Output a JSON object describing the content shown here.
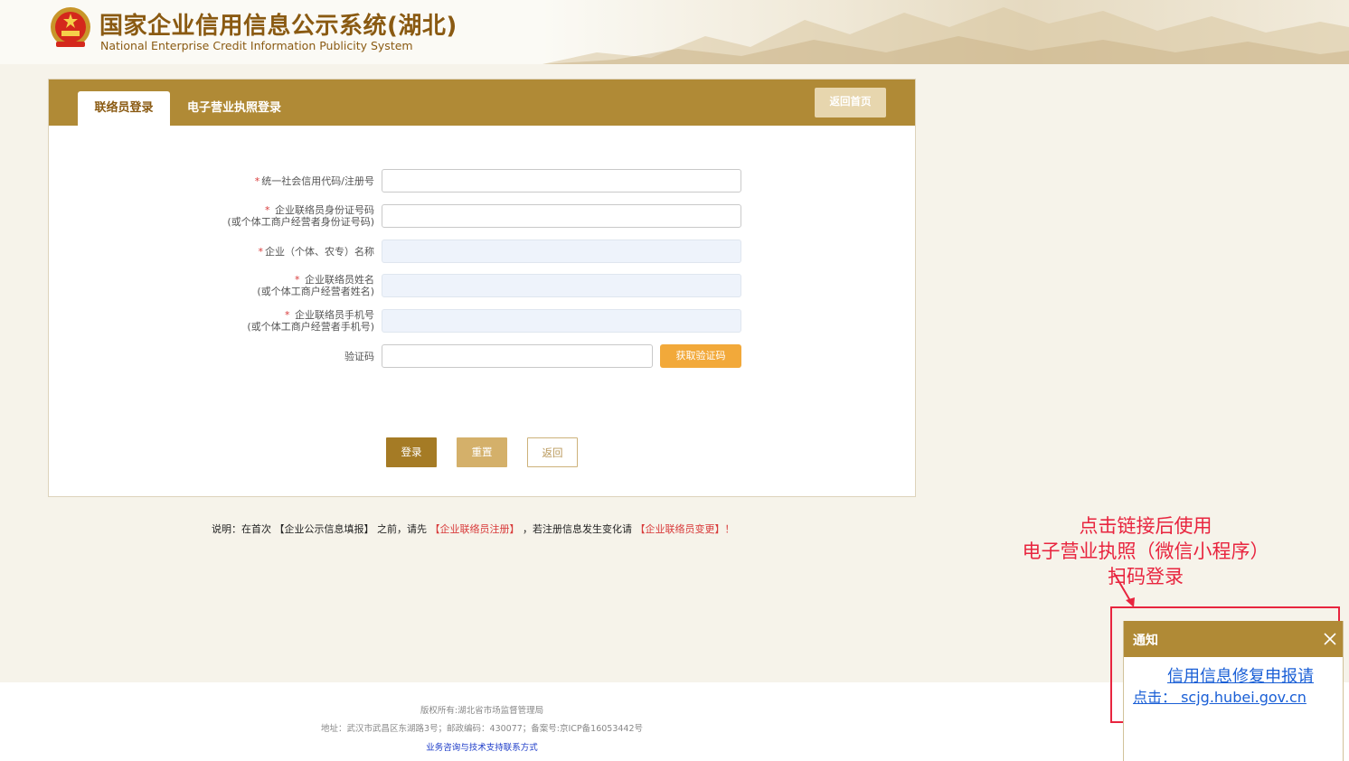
{
  "header": {
    "title": "国家企业信用信息公示系统(湖北)",
    "subtitle": "National Enterprise Credit Information Publicity System"
  },
  "tabs": [
    {
      "label": "联络员登录",
      "active": true
    },
    {
      "label": "电子营业执照登录",
      "active": false
    }
  ],
  "home_button": "返回首页",
  "form": {
    "fields": [
      {
        "star": "*",
        "label_line1": "统一社会信用代码/注册号",
        "label_line2": "",
        "value": ""
      },
      {
        "star": "*",
        "label_line1": "企业联络员身份证号码",
        "label_line2": "(或个体工商户经营者身份证号码)",
        "value": ""
      },
      {
        "star": "*",
        "label_line1": "企业（个体、农专）名称",
        "label_line2": "",
        "value": ""
      },
      {
        "star": "*",
        "label_line1": "企业联络员姓名",
        "label_line2": "(或个体工商户经营者姓名)",
        "value": ""
      },
      {
        "star": "*",
        "label_line1": "企业联络员手机号",
        "label_line2": "(或个体工商户经营者手机号)",
        "value": ""
      }
    ],
    "captcha_label": "验证码",
    "captcha_value": "",
    "captcha_button": "获取验证码"
  },
  "actions": {
    "login": "登录",
    "reset": "重置",
    "back": "返回"
  },
  "note": {
    "prefix": "说明：在首次 【企业公示信息填报】 之前，请先 ",
    "register": "【企业联络员注册】",
    "middle": " ，若注册信息发生变化请 ",
    "change": "【企业联络员变更】！"
  },
  "footer": {
    "copyright": "版权所有:湖北省市场监督管理局",
    "address": "地址：武汉市武昌区东湖路3号；邮政编码：430077；备案号:京ICP备16053442号",
    "support_link": "业务咨询与技术支持联系方式"
  },
  "annotation": {
    "line1": "点击链接后使用",
    "line2": "电子营业执照（微信小程序）",
    "line3": "扫码登录"
  },
  "notice": {
    "title": "通知",
    "line1": "信用信息修复申报请",
    "line2": "点击： scjg.hubei.gov.cn"
  },
  "colors": {
    "brand_gold": "#b08a36",
    "title_brown": "#8a5a12",
    "annotation_red": "#e8253f",
    "link_blue": "#1a5fd6",
    "captcha_orange": "#f2a93a"
  }
}
